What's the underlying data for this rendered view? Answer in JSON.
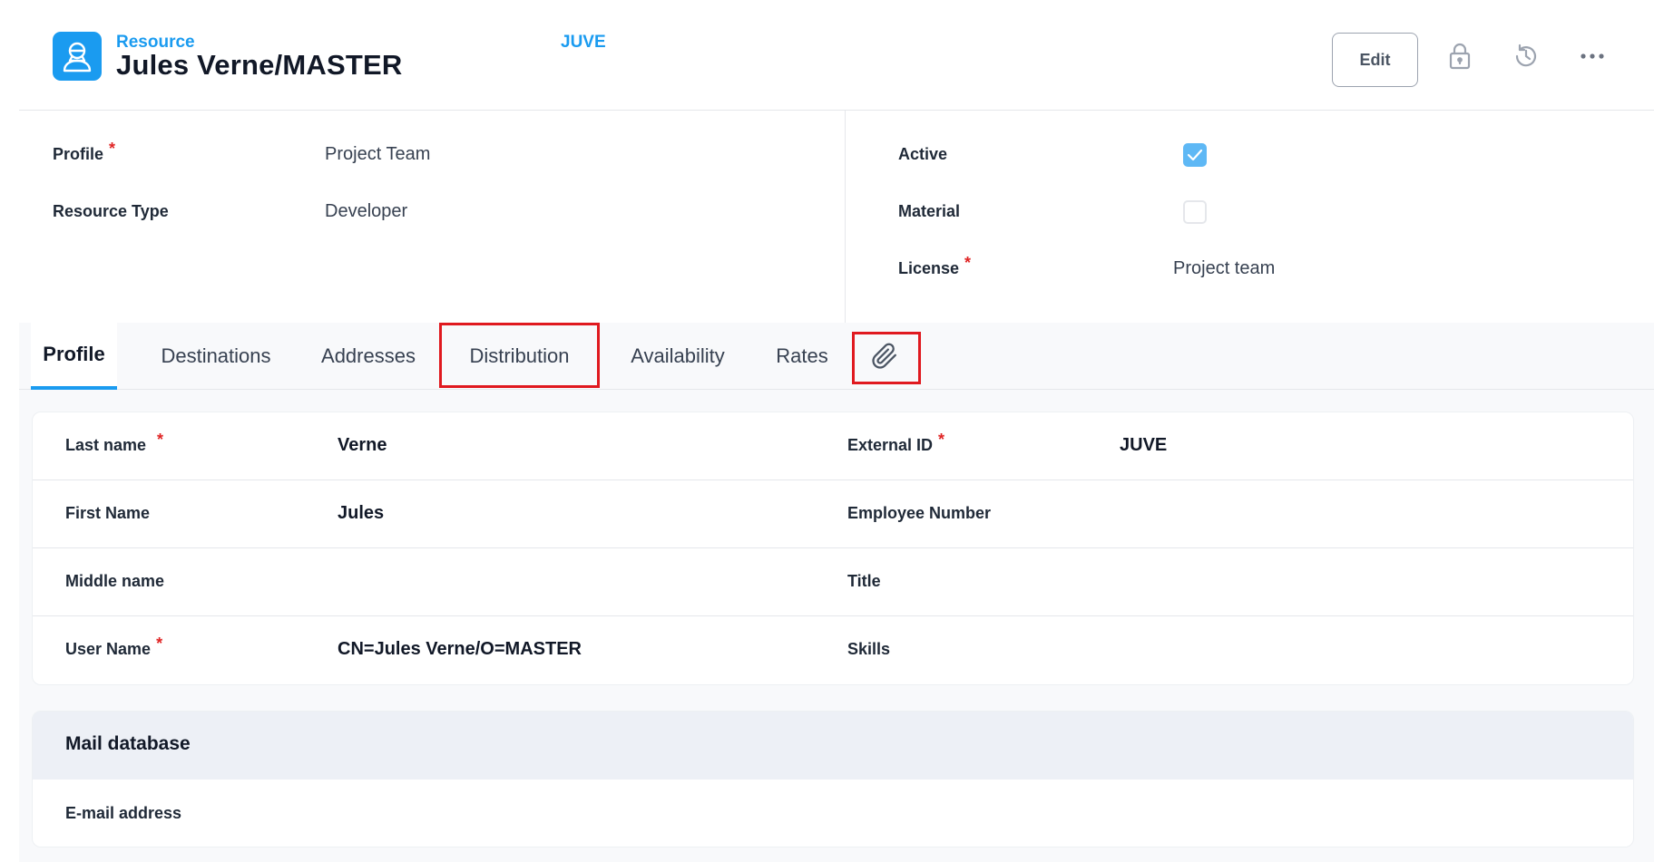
{
  "header": {
    "eyebrow": "Resource",
    "title": "Jules Verne/MASTER",
    "code": "JUVE",
    "edit_label": "Edit",
    "icons": [
      "lock-icon",
      "history-icon",
      "more-icon"
    ]
  },
  "summary": {
    "left": [
      {
        "label": "Profile",
        "required": "*",
        "value": "Project Team"
      },
      {
        "label": "Resource Type",
        "required": "",
        "value": "Developer"
      }
    ],
    "right": [
      {
        "label": "Active",
        "required": "",
        "checked": true
      },
      {
        "label": "Material",
        "required": "",
        "checked": false
      },
      {
        "label": "License",
        "required": "*",
        "value": "Project team"
      }
    ]
  },
  "tabs": [
    {
      "label": "Profile",
      "active": true
    },
    {
      "label": "Destinations"
    },
    {
      "label": "Addresses"
    },
    {
      "label": "Distribution",
      "highlighted": true
    },
    {
      "label": "Availability"
    },
    {
      "label": "Rates"
    },
    {
      "icon": "paperclip-icon",
      "highlighted": true
    }
  ],
  "profile_fields": [
    {
      "label": "Last name",
      "required": "*",
      "value": "Verne",
      "label2": "External ID",
      "required2": "*",
      "value2": "JUVE"
    },
    {
      "label": "First Name",
      "required": "",
      "value": "Jules",
      "label2": "Employee Number",
      "required2": "",
      "value2": ""
    },
    {
      "label": "Middle name",
      "required": "",
      "value": "",
      "label2": "Title",
      "required2": "",
      "value2": ""
    },
    {
      "label": "User Name",
      "required": "*",
      "value": "CN=Jules Verne/O=MASTER",
      "label2": "Skills",
      "required2": "",
      "value2": ""
    }
  ],
  "mail_section": {
    "title": "Mail database",
    "fields": [
      {
        "label": "E-mail address",
        "value": ""
      }
    ]
  },
  "colors": {
    "accent": "#1a9bf0",
    "required": "#e02424",
    "highlight": "#e0191f",
    "checkbox_on": "#5eb8f5"
  }
}
